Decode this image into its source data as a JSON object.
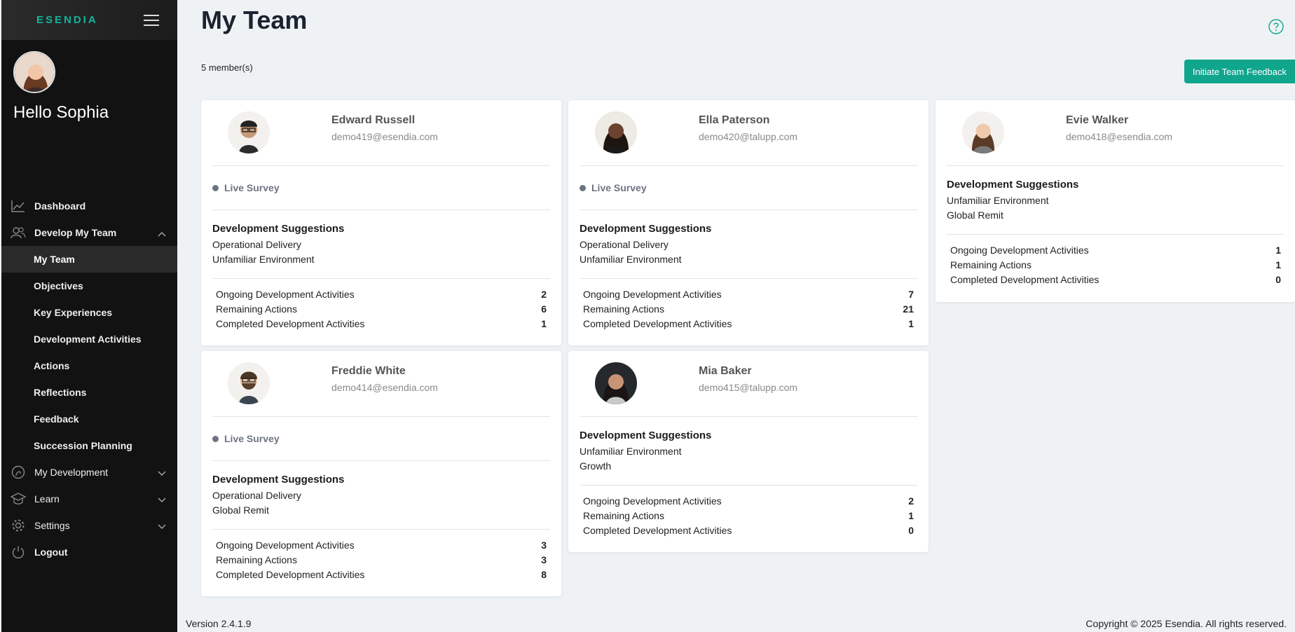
{
  "sidebar": {
    "logo": "ESENDIA",
    "greeting": "Hello Sophia",
    "items": {
      "dashboard": "Dashboard",
      "develop_my_team": "Develop My Team",
      "my_team": "My Team",
      "objectives": "Objectives",
      "key_experiences": "Key Experiences",
      "development_activities": "Development Activities",
      "actions": "Actions",
      "reflections": "Reflections",
      "feedback": "Feedback",
      "succession_planning": "Succession Planning",
      "my_development": "My Development",
      "learn": "Learn",
      "settings": "Settings",
      "logout": "Logout"
    }
  },
  "header": {
    "title": "My Team",
    "member_count": "5 member(s)",
    "initiate_button": "Initiate Team Feedback"
  },
  "labels": {
    "live_survey": "Live Survey",
    "dev_suggestions": "Development Suggestions",
    "ongoing": "Ongoing Development Activities",
    "remaining": "Remaining Actions",
    "completed": "Completed Development Activities"
  },
  "members": [
    {
      "name": "Edward Russell",
      "email": "demo419@esendia.com",
      "live_survey": true,
      "suggestions": [
        "Operational Delivery",
        "Unfamiliar Environment"
      ],
      "ongoing": "2",
      "remaining": "6",
      "completed": "1"
    },
    {
      "name": "Ella Paterson",
      "email": "demo420@talupp.com",
      "live_survey": true,
      "suggestions": [
        "Operational Delivery",
        "Unfamiliar Environment"
      ],
      "ongoing": "7",
      "remaining": "21",
      "completed": "1"
    },
    {
      "name": "Evie Walker",
      "email": "demo418@esendia.com",
      "live_survey": false,
      "suggestions": [
        "Unfamiliar Environment",
        "Global Remit"
      ],
      "ongoing": "1",
      "remaining": "1",
      "completed": "0"
    },
    {
      "name": "Freddie White",
      "email": "demo414@esendia.com",
      "live_survey": true,
      "suggestions": [
        "Operational Delivery",
        "Global Remit"
      ],
      "ongoing": "3",
      "remaining": "3",
      "completed": "8"
    },
    {
      "name": "Mia Baker",
      "email": "demo415@talupp.com",
      "live_survey": false,
      "suggestions": [
        "Unfamiliar Environment",
        "Growth"
      ],
      "ongoing": "2",
      "remaining": "1",
      "completed": "0"
    }
  ],
  "footer": {
    "version": "Version 2.4.1.9",
    "copyright": "Copyright © 2025 Esendia. All rights reserved."
  },
  "colors": {
    "accent": "#10a58d",
    "sidebar_bg": "#121212",
    "page_bg": "#eff2f5"
  }
}
